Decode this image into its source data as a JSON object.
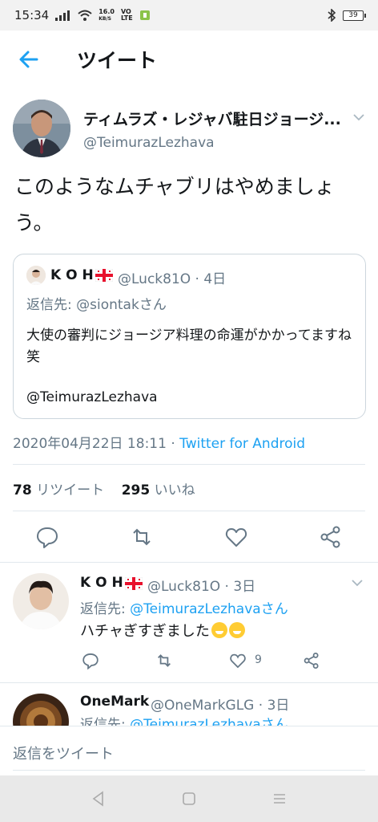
{
  "status_bar": {
    "time": "15:34",
    "net_speed": "16.0",
    "net_unit": "KB/S",
    "volte_top": "VO",
    "volte_bottom": "LTE",
    "battery": "39"
  },
  "header": {
    "title": "ツイート"
  },
  "tweet": {
    "author_name": "ティムラズ・レジャバ駐日ジョージ...",
    "author_handle": "@TeimurazLezhava",
    "text": "このようなムチャブリはやめましょう。",
    "quote": {
      "name": "K O H",
      "handle": "@Luck81O · 4日",
      "reply_to": "返信先: @siontakさん",
      "body": "大使の審判にジョージア料理の命運がかかってますね笑",
      "mention": "@TeimurazLezhava"
    },
    "date": "2020年04月22日 18:11 · ",
    "source": "Twitter for Android",
    "retweet_count": "78",
    "retweet_label": "リツイート",
    "like_count": "295",
    "like_label": "いいね"
  },
  "replies": [
    {
      "name": "K O H",
      "handle": "@Luck81O · 3日",
      "reply_prefix": "返信先: ",
      "reply_to": "@TeimurazLezhavaさん",
      "body": "ハチャぎすぎました",
      "like_count": "9"
    },
    {
      "name": "OneMark",
      "handle": "@OneMarkGLG · 3日",
      "reply_prefix": "返信先: ",
      "reply_to": "@TeimurazLezhavaさん"
    }
  ],
  "composer": {
    "placeholder": "返信をツイート"
  },
  "colors": {
    "accent": "#1da1f2",
    "secondary_text": "#657786",
    "divider": "#e1e8ed"
  }
}
